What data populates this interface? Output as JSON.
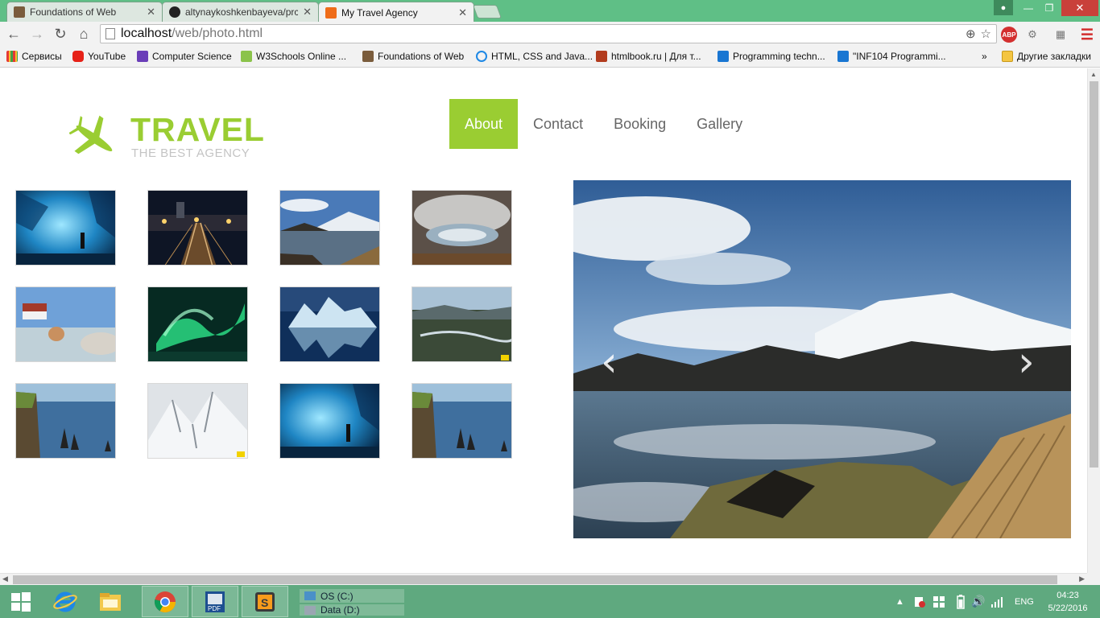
{
  "browser": {
    "tabs": [
      {
        "label": "Foundations of Web",
        "favicon_color": "#7a5c3c",
        "active": false
      },
      {
        "label": "altynaykoshkenbayeva/prc",
        "favicon_color": "#222222",
        "active": false
      },
      {
        "label": "My Travel Agency",
        "favicon_color": "#ef6c1a",
        "active": true
      }
    ],
    "url_host": "localhost",
    "url_path": "/web/photo.html",
    "profile_icon": "person-icon",
    "bookmarks": [
      {
        "label": "Сервисы",
        "icon": "apps-grid-icon",
        "color": "#e53935"
      },
      {
        "label": "YouTube",
        "icon": "youtube-icon",
        "color": "#e62117"
      },
      {
        "label": "Computer Science",
        "icon": "bookmark-avatar-icon",
        "color": "#6a3db8"
      },
      {
        "label": "W3Schools Online ...",
        "icon": "w3schools-icon",
        "color": "#8bc34a"
      },
      {
        "label": "Foundations of Web",
        "icon": "bookmark-avatar-icon",
        "color": "#7a5c3c"
      },
      {
        "label": "HTML, CSS and Java...",
        "icon": "link-loop-icon",
        "color": "#1e88e5"
      },
      {
        "label": "htmlbook.ru | Для т...",
        "icon": "htmlbook-icon",
        "color": "#b23b1e"
      },
      {
        "label": "Programming techn...",
        "icon": "bookmark-x-icon",
        "color": "#1976d2"
      },
      {
        "label": "\"INF104 Programmi...",
        "icon": "bookmark-x-icon",
        "color": "#1976d2"
      }
    ],
    "bookmarks_overflow": "»",
    "other_bookmarks": "Другие закладки"
  },
  "site": {
    "logo_title": "TRAVEL",
    "logo_subtitle": "THE BEST AGENCY",
    "accent": "#9acd32",
    "nav": [
      {
        "label": "About",
        "active": true
      },
      {
        "label": "Contact",
        "active": false
      },
      {
        "label": "Booking",
        "active": false
      },
      {
        "label": "Gallery",
        "active": false
      }
    ],
    "gallery": [
      "ice-cave",
      "railway-night",
      "mountain-lake-boardwalk",
      "cloud-reflection-fisheye",
      "hot-spring-bather",
      "aurora-borealis",
      "iceberg-reflection",
      "valley-river-overlook",
      "sea-stacks-cliff",
      "snowy-mountains",
      "ice-cave",
      "sea-stacks-cliff"
    ],
    "slider": {
      "current_image": "mountain-lake-boardwalk",
      "prev_symbol": "‹",
      "next_symbol": "›"
    }
  },
  "taskbar": {
    "drives": [
      "OS (C:)",
      "Data (D:)"
    ],
    "language": "ENG",
    "time": "04:23",
    "date": "5/22/2016"
  }
}
